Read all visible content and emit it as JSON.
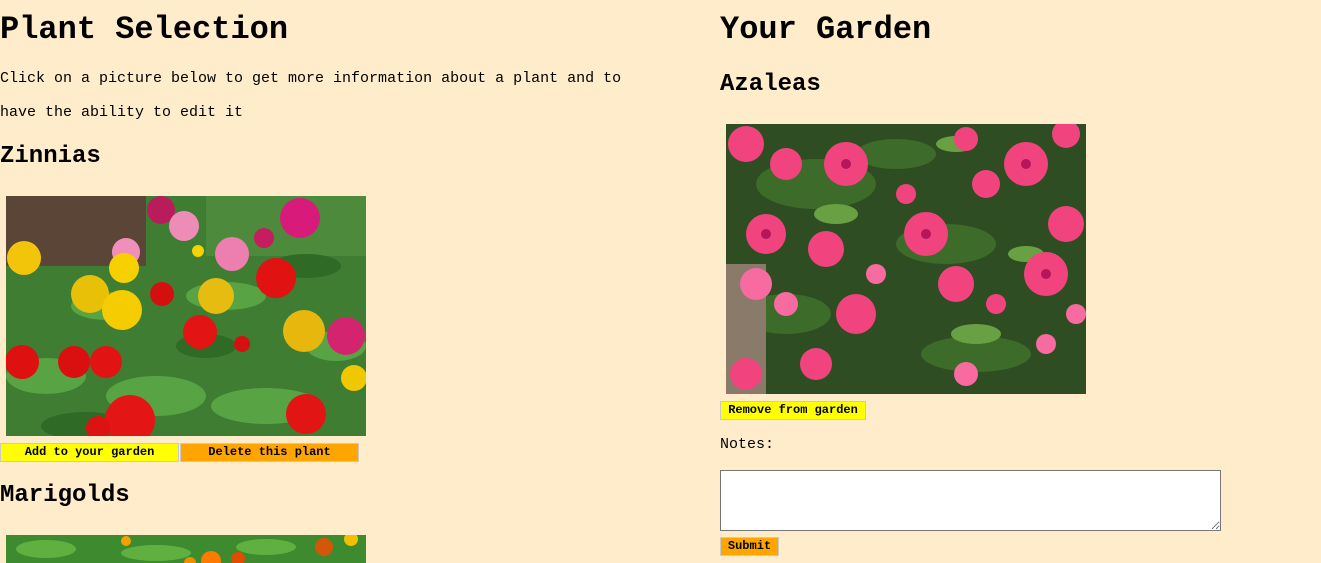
{
  "selection": {
    "title": "Plant Selection",
    "intro": "Click on a picture below to get more information about a plant and to have the ability to edit it",
    "plants": [
      {
        "name": "Zinnias",
        "image_subject": "zinnia-flowers",
        "add_label": "Add to your garden",
        "delete_label": "Delete this plant"
      },
      {
        "name": "Marigolds",
        "image_subject": "marigold-flowers"
      }
    ]
  },
  "garden": {
    "title": "Your Garden",
    "plants": [
      {
        "name": "Azaleas",
        "image_subject": "azalea-flowers",
        "remove_label": "Remove from garden",
        "notes_label": "Notes:",
        "notes_value": "",
        "submit_label": "Submit"
      }
    ]
  },
  "colors": {
    "page_background": "#ffeccb",
    "add_button": "#ffff00",
    "delete_button": "#ffa500",
    "remove_button": "#ffff00",
    "submit_button": "#ffa500"
  }
}
